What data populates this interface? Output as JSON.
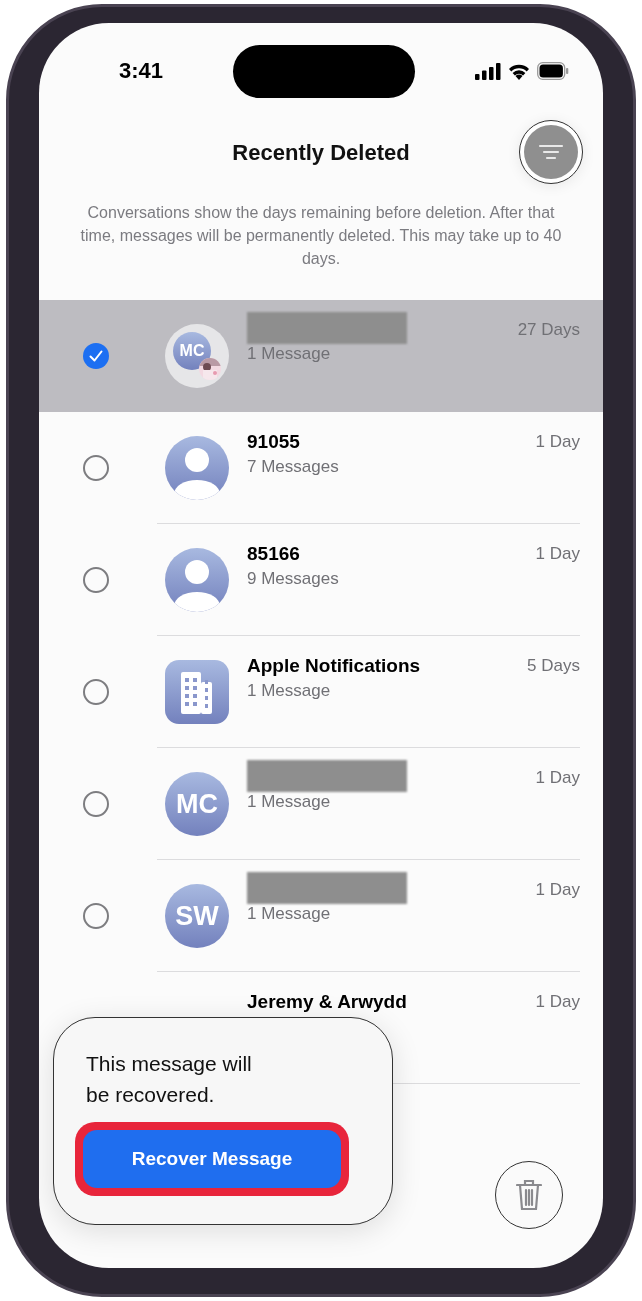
{
  "status_bar": {
    "time": "3:41"
  },
  "header": {
    "title": "Recently Deleted"
  },
  "description": "Conversations show the days remaining before deletion. After that time, messages will be permanently deleted. This may take up to 40 days.",
  "conversations": [
    {
      "name_blurred": true,
      "avatar": {
        "kind": "group",
        "initials": "MC"
      },
      "subtitle": "1 Message",
      "days": "27 Days",
      "selected": true
    },
    {
      "name": "91055",
      "avatar": {
        "kind": "person"
      },
      "subtitle": "7 Messages",
      "days": "1 Day",
      "selected": false
    },
    {
      "name": "85166",
      "avatar": {
        "kind": "person"
      },
      "subtitle": "9 Messages",
      "days": "1 Day",
      "selected": false
    },
    {
      "name": "Apple Notifications",
      "avatar": {
        "kind": "business"
      },
      "subtitle": "1 Message",
      "days": "5 Days",
      "selected": false
    },
    {
      "name_blurred": true,
      "avatar": {
        "kind": "initials",
        "initials": "MC"
      },
      "subtitle": "1 Message",
      "days": "1 Day",
      "selected": false
    },
    {
      "name_blurred": true,
      "avatar": {
        "kind": "initials",
        "initials": "SW"
      },
      "subtitle": "1 Message",
      "days": "1 Day",
      "selected": false
    },
    {
      "name": "Jeremy & Arwydd",
      "days": "1 Day"
    }
  ],
  "popup": {
    "text": "This message will be recovered.",
    "button": "Recover Message",
    "highlighted": true
  }
}
